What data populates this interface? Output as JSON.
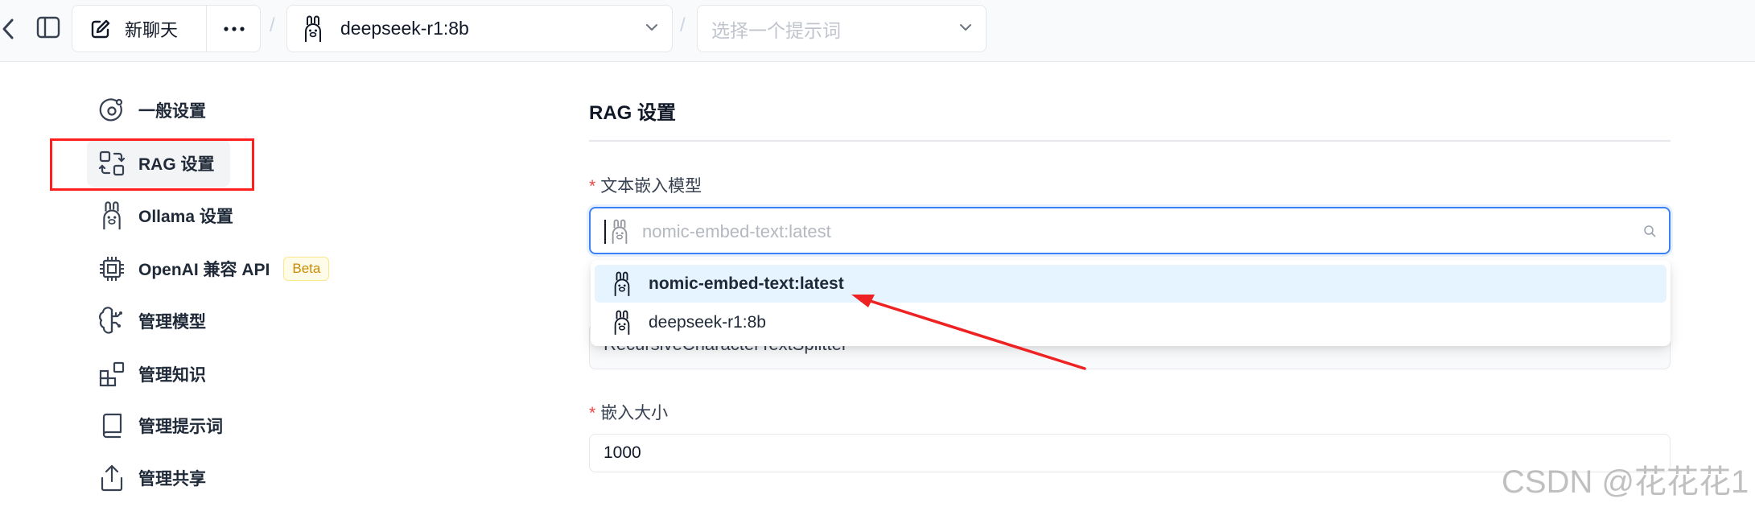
{
  "topbar": {
    "new_chat_label": "新聊天",
    "separator": "/",
    "model_value": "deepseek-r1:8b",
    "prompt_placeholder": "选择一个提示词"
  },
  "sidebar": {
    "items": [
      {
        "label": "一般设置",
        "icon": "general-settings-icon"
      },
      {
        "label": "RAG 设置",
        "icon": "rag-icon",
        "active": true
      },
      {
        "label": "Ollama 设置",
        "icon": "ollama-icon"
      },
      {
        "label": "OpenAI 兼容 API",
        "icon": "chip-icon",
        "badge": "Beta"
      },
      {
        "label": "管理模型",
        "icon": "brain-icon"
      },
      {
        "label": "管理知识",
        "icon": "blocks-icon"
      },
      {
        "label": "管理提示词",
        "icon": "book-icon"
      },
      {
        "label": "管理共享",
        "icon": "share-icon"
      }
    ]
  },
  "main": {
    "section_title": "RAG 设置",
    "embed_model": {
      "required_mark": "*",
      "label": "文本嵌入模型",
      "placeholder": "nomic-embed-text:latest",
      "options": [
        {
          "label": "nomic-embed-text:latest",
          "selected": true
        },
        {
          "label": "deepseek-r1:8b",
          "selected": false
        }
      ]
    },
    "splitter": {
      "value": "RecursiveCharacterTextSplitter"
    },
    "chunk_size": {
      "required_mark": "*",
      "label": "嵌入大小",
      "value": "1000"
    }
  },
  "colors": {
    "highlight": "#ff1f1f",
    "focus": "#3b82f6",
    "selected_option_bg": "#e6f4ff",
    "beta_badge": "#ca8a04"
  },
  "watermark": "CSDN @花花花1"
}
